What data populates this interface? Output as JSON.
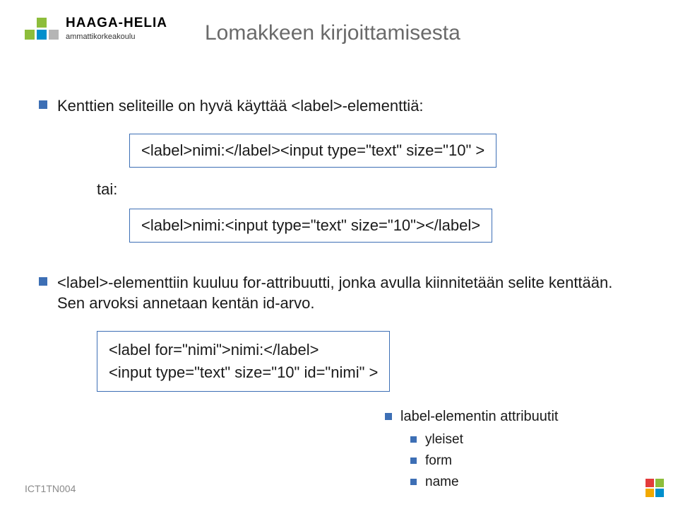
{
  "logo": {
    "name": "HAAGA-HELIA",
    "subtitle": "ammattikorkeakoulu",
    "colors": {
      "green": "#8dbd3b",
      "blue": "#008fcc",
      "gray": "#b5b5b5"
    }
  },
  "title": "Lomakkeen kirjoittamisesta",
  "bullets": {
    "b1": "Kenttien seliteille on hyvä käyttää <label>-elementtiä:",
    "tai": "tai:",
    "b2": "<label>-elementtiin kuuluu for-attribuutti, jonka avulla kiinnitetään selite kenttään. Sen arvoksi annetaan kentän id-arvo."
  },
  "codeboxes": {
    "c1": "<label>nimi:</label><input type=\"text\" size=\"10\" >",
    "c2": "<label>nimi:<input type=\"text\" size=\"10\"></label>",
    "c3_line1": "<label for=\"nimi\">nimi:</label>",
    "c3_line2": "<input type=\"text\" size=\"10\" id=\"nimi\" >"
  },
  "sublist": {
    "heading": "label-elementin attribuutit",
    "items": [
      "yleiset",
      "form",
      "name"
    ]
  },
  "footer": "ICT1TN004",
  "corner_colors": [
    "#e33b3b",
    "#8dbd3b",
    "#f2a900",
    "#008fcc"
  ]
}
